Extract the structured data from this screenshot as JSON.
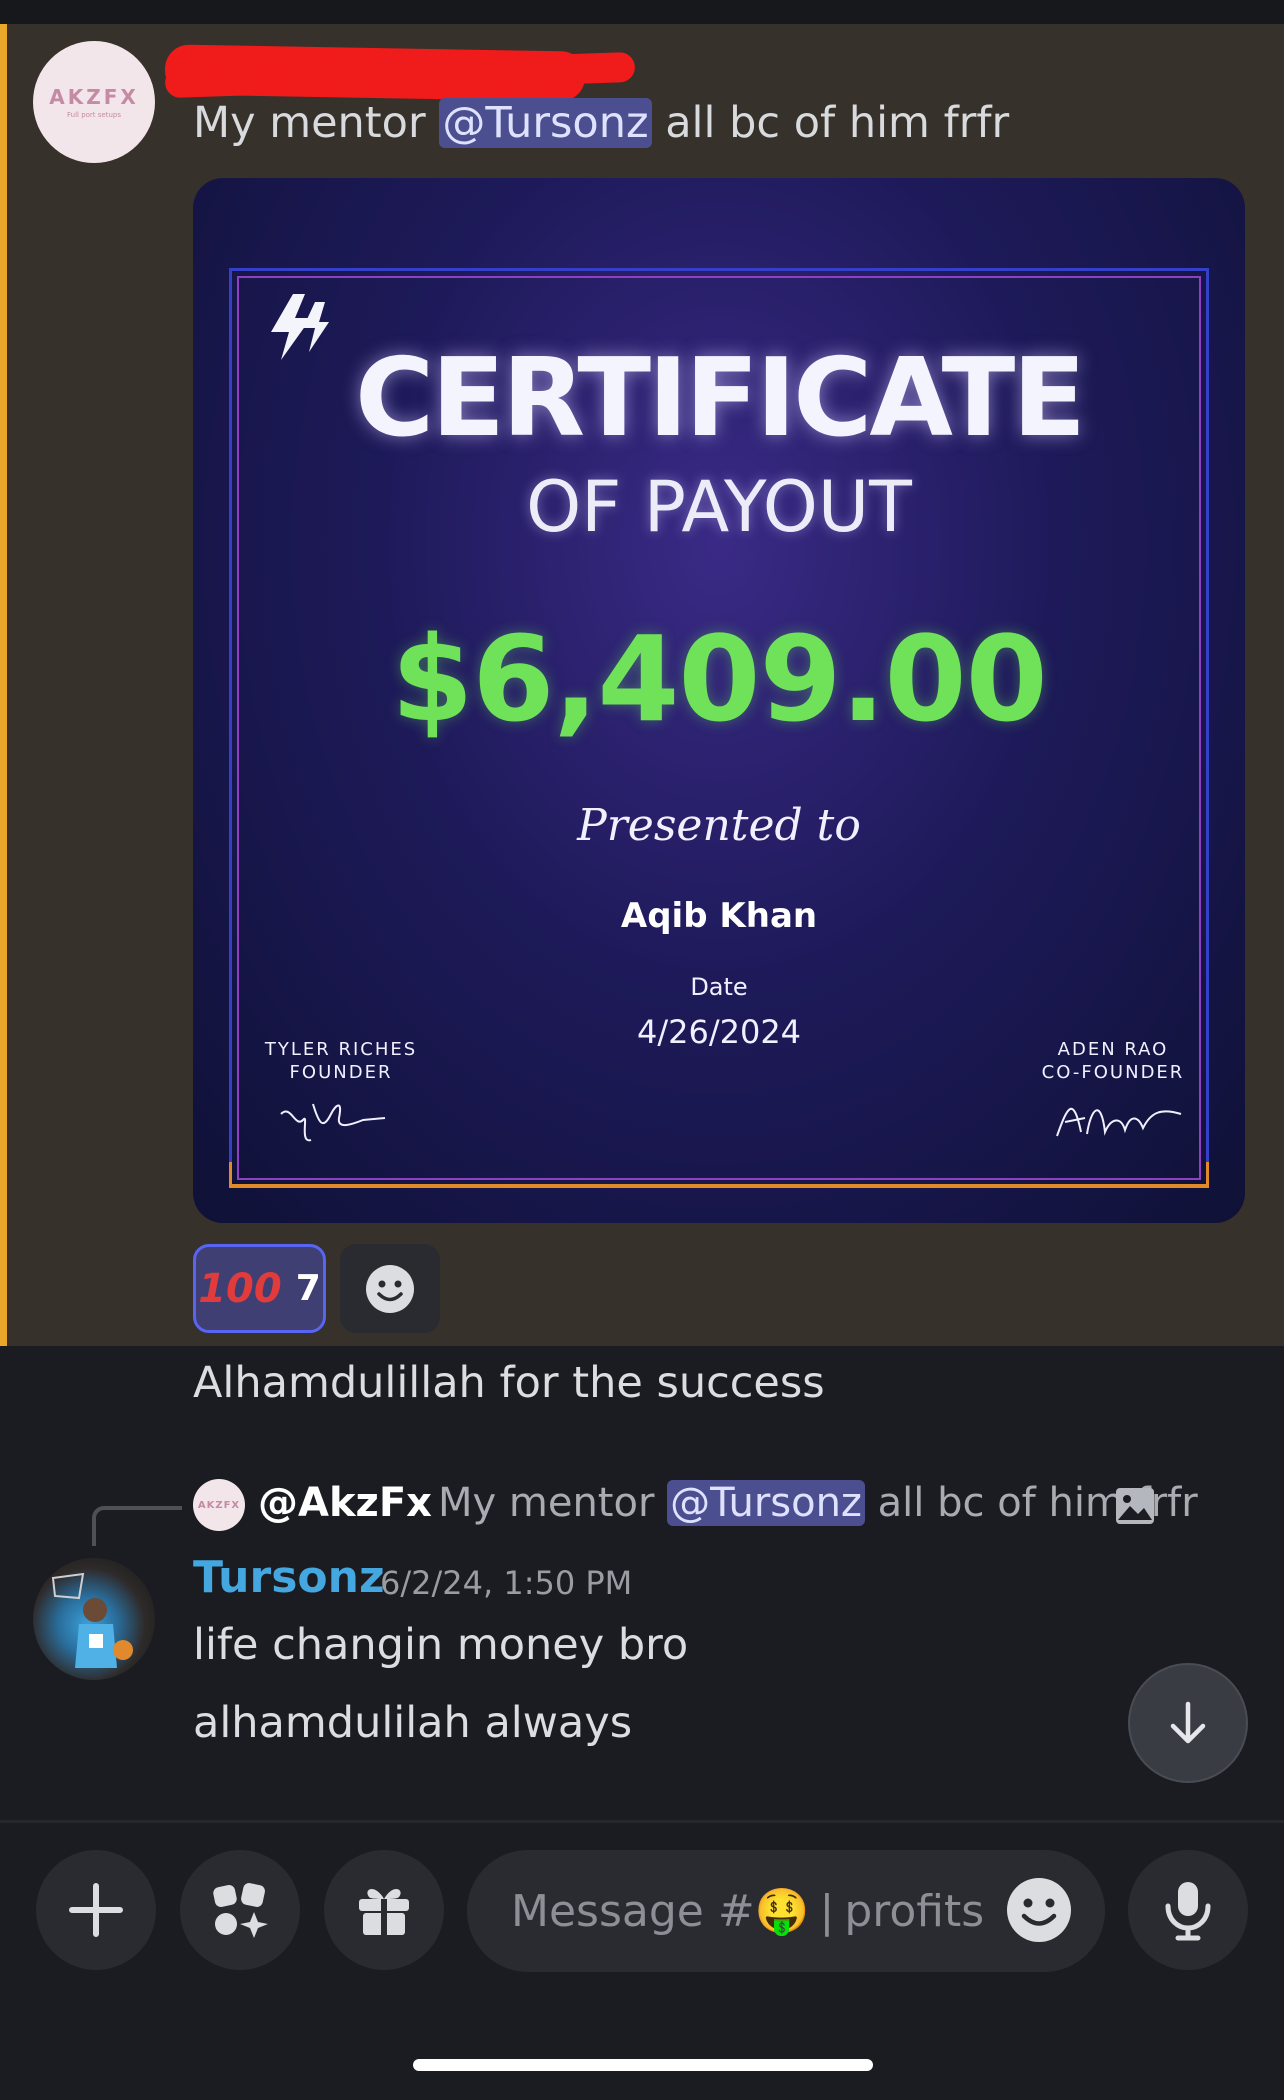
{
  "message1": {
    "avatar_logo": "AKZFX",
    "avatar_logo_sub": "Full port setups",
    "text_before": "My mentor ",
    "mention": "@Tursonz",
    "text_after": " all bc of him frfr"
  },
  "certificate": {
    "logo": "4",
    "title": "CERTIFICATE",
    "subtitle": "OF PAYOUT",
    "amount": "$6,409.00",
    "presented": "Presented to",
    "name": "Aqib Khan",
    "date_label": "Date",
    "date": "4/26/2024",
    "left_sig_name": "TYLER RICHES",
    "left_sig_role": "FOUNDER",
    "right_sig_name": "ADEN RAO",
    "right_sig_role": "CO-FOUNDER"
  },
  "reaction": {
    "emoji": "100",
    "count": "7"
  },
  "message2": {
    "text": "Alhamdulillah for the success"
  },
  "reply": {
    "avatar_logo": "AKZFX",
    "author": "@AkzFx",
    "text_before": "My mentor ",
    "mention": "@Tursonz",
    "text_after": " all bc of him frfr"
  },
  "message3": {
    "author": "Tursonz",
    "timestamp": "6/2/24, 1:50 PM",
    "line1": "life changin money bro",
    "line2": "alhamdulilah always"
  },
  "composer": {
    "placeholder_prefix": "Message #",
    "channel_emoji": "🤑",
    "separator": "|",
    "channel_name": "profits"
  },
  "colors": {
    "highlight_bg": "#36312a",
    "highlight_bar": "#e9a82a",
    "mention_bg": "#4c4f8f",
    "author_color": "#44a7e0",
    "amount_green": "#6fe25a"
  }
}
